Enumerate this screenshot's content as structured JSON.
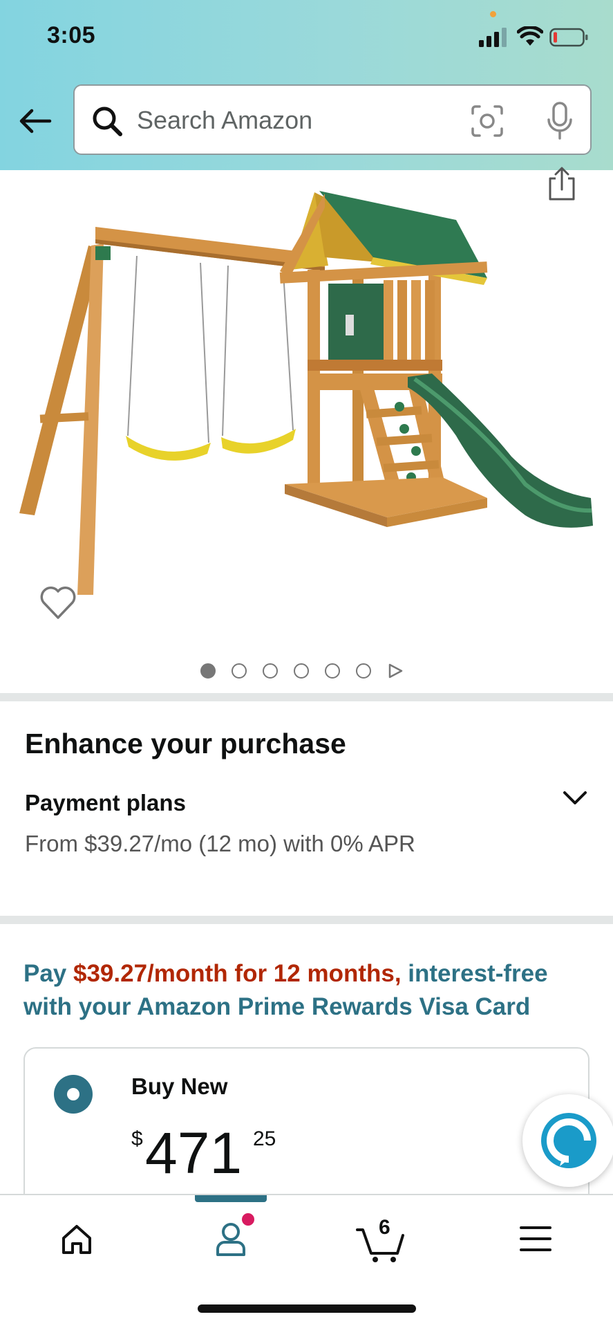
{
  "status_bar": {
    "time": "3:05"
  },
  "header": {
    "search_placeholder": "Search Amazon"
  },
  "carousel": {
    "image_count": 6,
    "active_index": 0
  },
  "enhance": {
    "title": "Enhance your purchase",
    "plans_title": "Payment plans",
    "plans_text": "From $39.27/mo (12 mo) with 0% APR"
  },
  "promo": {
    "pre": "Pay ",
    "highlight": "$39.27/month for 12 months,",
    "post": " interest-free with your Amazon Prime Rewards Visa Card"
  },
  "buy_box": {
    "label": "Buy New",
    "currency": "$",
    "price_whole": "471",
    "price_fraction": "25"
  },
  "nav": {
    "cart_count": "6",
    "items": [
      "home-icon",
      "account-icon",
      "cart-icon",
      "menu-icon"
    ]
  },
  "colors": {
    "accent": "#2d7185",
    "price_red": "#b12704",
    "notification": "#d81b60"
  }
}
